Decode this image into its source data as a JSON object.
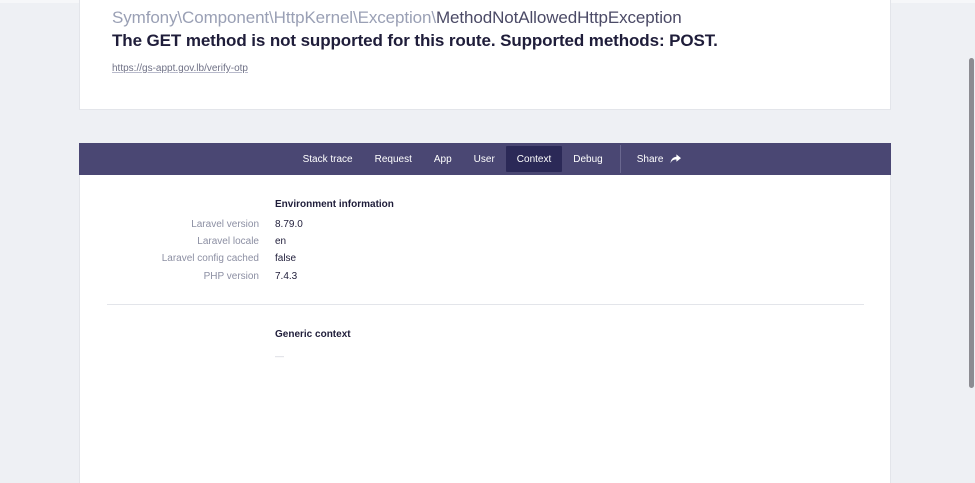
{
  "header": {
    "exception_namespace": "Symfony\\Component\\HttpKernel\\Exception\\",
    "exception_class": "MethodNotAllowedHttpException",
    "message": "The GET method is not supported for this route. Supported methods: POST.",
    "url": "https://gs-appt.gov.lb/verify-otp"
  },
  "tabs": {
    "stack_trace": "Stack trace",
    "request": "Request",
    "app": "App",
    "user": "User",
    "context": "Context",
    "debug": "Debug",
    "share": "Share",
    "active": "Context"
  },
  "environment": {
    "heading": "Environment information",
    "rows": [
      {
        "label": "Laravel version",
        "value": "8.79.0"
      },
      {
        "label": "Laravel locale",
        "value": "en"
      },
      {
        "label": "Laravel config cached",
        "value": "false"
      },
      {
        "label": "PHP version",
        "value": "7.4.3"
      }
    ]
  },
  "generic_context": {
    "heading": "Generic context",
    "value": "—"
  },
  "colors": {
    "tab_bar": "#4a4773",
    "tab_active": "#2b2957",
    "background": "#eef0f4"
  },
  "icons": {
    "share": "share-arrow-icon"
  }
}
